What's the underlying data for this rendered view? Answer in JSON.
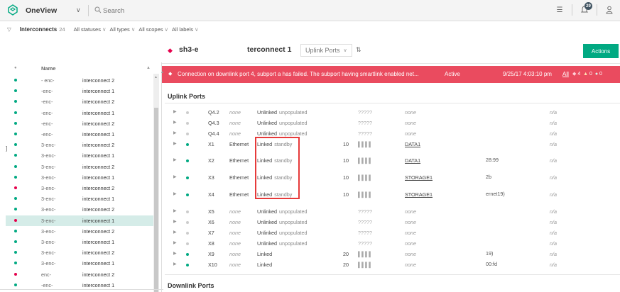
{
  "topbar": {
    "app_name": "OneView",
    "search_placeholder": "Search",
    "notification_count": "29"
  },
  "filters": {
    "title": "Interconnects",
    "count": "24",
    "statuses": "All statuses",
    "types": "All types",
    "scopes": "All scopes",
    "labels": "All labels"
  },
  "list": {
    "col_name": "Name",
    "rows": [
      {
        "status": "ok",
        "enclosure": "- enc- ",
        "name": "interconnect 2",
        "selected": false
      },
      {
        "status": "ok",
        "enclosure": "-enc-",
        "name": "interconnect 1",
        "selected": false
      },
      {
        "status": "ok",
        "enclosure": "-enc-",
        "name": "interconnect 2",
        "selected": false
      },
      {
        "status": "ok",
        "enclosure": "-enc-",
        "name": "interconnect 1",
        "selected": false
      },
      {
        "status": "ok",
        "enclosure": "-enc-",
        "name": "interconnect 2",
        "selected": false
      },
      {
        "status": "ok",
        "enclosure": "-enc-",
        "name": "interconnect 1",
        "selected": false
      },
      {
        "status": "ok",
        "enclosure": "3-enc-",
        "name": "interconnect 2",
        "selected": false
      },
      {
        "status": "ok",
        "enclosure": "3-enc-",
        "name": "interconnect 1",
        "selected": false
      },
      {
        "status": "ok",
        "enclosure": "3-enc-",
        "name": "interconnect 2",
        "selected": false
      },
      {
        "status": "ok",
        "enclosure": "3-enc-",
        "name": "interconnect 1",
        "selected": false
      },
      {
        "status": "critical",
        "enclosure": "3-enc-",
        "name": "interconnect 2",
        "selected": false
      },
      {
        "status": "ok",
        "enclosure": "3-enc-",
        "name": "interconnect 1",
        "selected": false
      },
      {
        "status": "ok",
        "enclosure": "3-enc-",
        "name": "interconnect 2",
        "selected": false
      },
      {
        "status": "critical",
        "enclosure": "3-enc-",
        "name": "interconnect 1",
        "selected": true
      },
      {
        "status": "ok",
        "enclosure": "3-enc-",
        "name": "interconnect 2",
        "selected": false
      },
      {
        "status": "ok",
        "enclosure": "3-enc-",
        "name": "interconnect 1",
        "selected": false
      },
      {
        "status": "ok",
        "enclosure": "3-enc-",
        "name": "interconnect 2",
        "selected": false
      },
      {
        "status": "ok",
        "enclosure": "3-enc-",
        "name": "interconnect 1",
        "selected": false
      },
      {
        "status": "critical",
        "enclosure": "enc-",
        "name": "interconnect 2",
        "selected": false
      },
      {
        "status": "ok",
        "enclosure": "-enc-",
        "name": "interconnect 1",
        "selected": false
      }
    ]
  },
  "details": {
    "title_left": "sh3-e",
    "title_right": "terconnect 1",
    "view": "Uplink Ports",
    "actions": "Actions"
  },
  "alert": {
    "text": "Connection on downlink port 4, subport a has failed. The subport having smartlink enabled net...",
    "state": "Active",
    "time": "9/25/17  4:03:10 pm",
    "all": "All",
    "critical_count": "4",
    "warning_count": "0",
    "ok_count": "0"
  },
  "uplink": {
    "title": "Uplink Ports",
    "rows": [
      {
        "port": "Q4.2",
        "type": "none",
        "state": "Unlinked",
        "sub": "unpopulated",
        "speed": "",
        "bars": "?????",
        "network": "none",
        "conn": "",
        "na": "n/a",
        "on": false
      },
      {
        "port": "Q4.3",
        "type": "none",
        "state": "Unlinked",
        "sub": "unpopulated",
        "speed": "",
        "bars": "?????",
        "network": "none",
        "conn": "",
        "na": "n/a",
        "on": false
      },
      {
        "port": "Q4.4",
        "type": "none",
        "state": "Unlinked",
        "sub": "unpopulated",
        "speed": "",
        "bars": "?????",
        "network": "none",
        "conn": "",
        "na": "n/a",
        "on": false
      },
      {
        "port": "X1",
        "type": "Ethernet",
        "state": "Linked",
        "sub": "standby",
        "speed": "10",
        "bars": "▌▌▌▌",
        "network": "DATA1",
        "conn": "",
        "na": "n/a",
        "on": true
      },
      {
        "port": "X2",
        "type": "Ethernet",
        "state": "Linked",
        "sub": "standby",
        "speed": "10",
        "bars": "▌▌▌▌",
        "network": "DATA1",
        "conn": "28:99",
        "na": "n/a",
        "on": true
      },
      {
        "port": "X3",
        "type": "Ethernet",
        "state": "Linked",
        "sub": "standby",
        "speed": "10",
        "bars": "▌▌▌▌",
        "network": "STORAGE1",
        "conn": "2b",
        "na": "n/a",
        "on": true
      },
      {
        "port": "X4",
        "type": "Ethernet",
        "state": "Linked",
        "sub": "standby",
        "speed": "10",
        "bars": "▌▌▌▌",
        "network": "STORAGE1",
        "conn": "ernet19)",
        "na": "n/a",
        "on": true
      },
      {
        "port": "X5",
        "type": "none",
        "state": "Unlinked",
        "sub": "unpopulated",
        "speed": "",
        "bars": "?????",
        "network": "none",
        "conn": "",
        "na": "n/a",
        "on": false
      },
      {
        "port": "X6",
        "type": "none",
        "state": "Unlinked",
        "sub": "unpopulated",
        "speed": "",
        "bars": "?????",
        "network": "none",
        "conn": "",
        "na": "n/a",
        "on": false
      },
      {
        "port": "X7",
        "type": "none",
        "state": "Unlinked",
        "sub": "unpopulated",
        "speed": "",
        "bars": "?????",
        "network": "none",
        "conn": "",
        "na": "n/a",
        "on": false
      },
      {
        "port": "X8",
        "type": "none",
        "state": "Unlinked",
        "sub": "unpopulated",
        "speed": "",
        "bars": "?????",
        "network": "none",
        "conn": "",
        "na": "n/a",
        "on": false
      },
      {
        "port": "X9",
        "type": "none",
        "state": "Linked",
        "sub": "",
        "speed": "20",
        "bars": "▌▌▌▌",
        "network": "none",
        "conn": "19)",
        "na": "n/a",
        "on": true
      },
      {
        "port": "X10",
        "type": "none",
        "state": "Linked",
        "sub": "",
        "speed": "20",
        "bars": "▌▌▌▌",
        "network": "none",
        "conn": "00:fd",
        "na": "n/a",
        "on": true
      }
    ]
  },
  "downlink": {
    "title": "Downlink Ports"
  },
  "colors": {
    "accent": "#01a982",
    "critical": "#e5004c",
    "alert_bg": "#ea4b5f",
    "highlight": "#e63a3a"
  }
}
